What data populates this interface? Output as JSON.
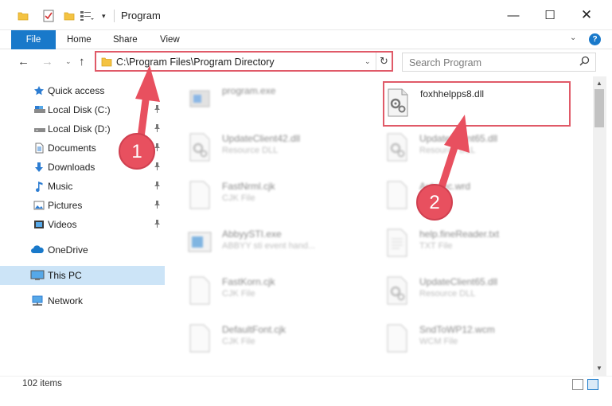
{
  "window": {
    "title": "Program",
    "minimize_glyph": "—",
    "maximize_glyph": "☐",
    "close_glyph": "✕"
  },
  "ribbon": {
    "tabs": [
      "File",
      "Home",
      "Share",
      "View"
    ],
    "expand_glyph": "⌄",
    "help_glyph": "?"
  },
  "navigation": {
    "back_glyph": "←",
    "forward_glyph": "→",
    "recent_glyph": "⌄",
    "up_glyph": "↑",
    "address": "C:\\Program Files\\Program Directory",
    "address_dropdown_glyph": "⌄",
    "refresh_glyph": "↻",
    "search_placeholder": "Search Program",
    "search_glyph": "⚲"
  },
  "sidebar": {
    "items": [
      {
        "label": "Quick access",
        "icon": "star-icon"
      },
      {
        "label": "Local Disk (C:)",
        "icon": "drive-icon",
        "pinned": true
      },
      {
        "label": "Local Disk (D:)",
        "icon": "drive-icon",
        "pinned": true
      },
      {
        "label": "Documents",
        "icon": "document-icon",
        "pinned": true
      },
      {
        "label": "Downloads",
        "icon": "download-icon",
        "pinned": true
      },
      {
        "label": "Music",
        "icon": "music-icon",
        "pinned": true
      },
      {
        "label": "Pictures",
        "icon": "pictures-icon",
        "pinned": true
      },
      {
        "label": "Videos",
        "icon": "video-icon",
        "pinned": true
      },
      {
        "label": "OneDrive",
        "icon": "cloud-icon"
      },
      {
        "label": "This PC",
        "icon": "computer-icon",
        "selected": true
      },
      {
        "label": "Network",
        "icon": "network-icon"
      }
    ],
    "pin_glyph": "📌"
  },
  "files": [
    {
      "name": "program.exe",
      "type": ""
    },
    {
      "name": "foxhhelpps8.dll",
      "type": ""
    },
    {
      "name": "UpdateClient42.dll",
      "type": "Resource DLL"
    },
    {
      "name": "UpdateClient65.dll",
      "type": "Resource DLL"
    },
    {
      "name": "FastNrml.cjk",
      "type": "CJK File"
    },
    {
      "name": "Autorec.wrd",
      "type": ""
    },
    {
      "name": "AbbyySTI.exe",
      "type": "ABBYY sti event hand..."
    },
    {
      "name": "help.fineReader.txt",
      "type": "TXT File"
    },
    {
      "name": "FastKorn.cjk",
      "type": "CJK File"
    },
    {
      "name": "UpdateClient65.dll",
      "type": "Resource DLL"
    },
    {
      "name": "DefaultFont.cjk",
      "type": "CJK File"
    },
    {
      "name": "SndToWP12.wcm",
      "type": "WCM File"
    }
  ],
  "annotations": {
    "badge_1": "1",
    "badge_2": "2"
  },
  "status": {
    "item_count": "102 items"
  },
  "colors": {
    "accent": "#1979ca",
    "highlight_box": "#e05a68",
    "annotation_arrow": "#e8505f",
    "selection": "#cce4f7"
  }
}
